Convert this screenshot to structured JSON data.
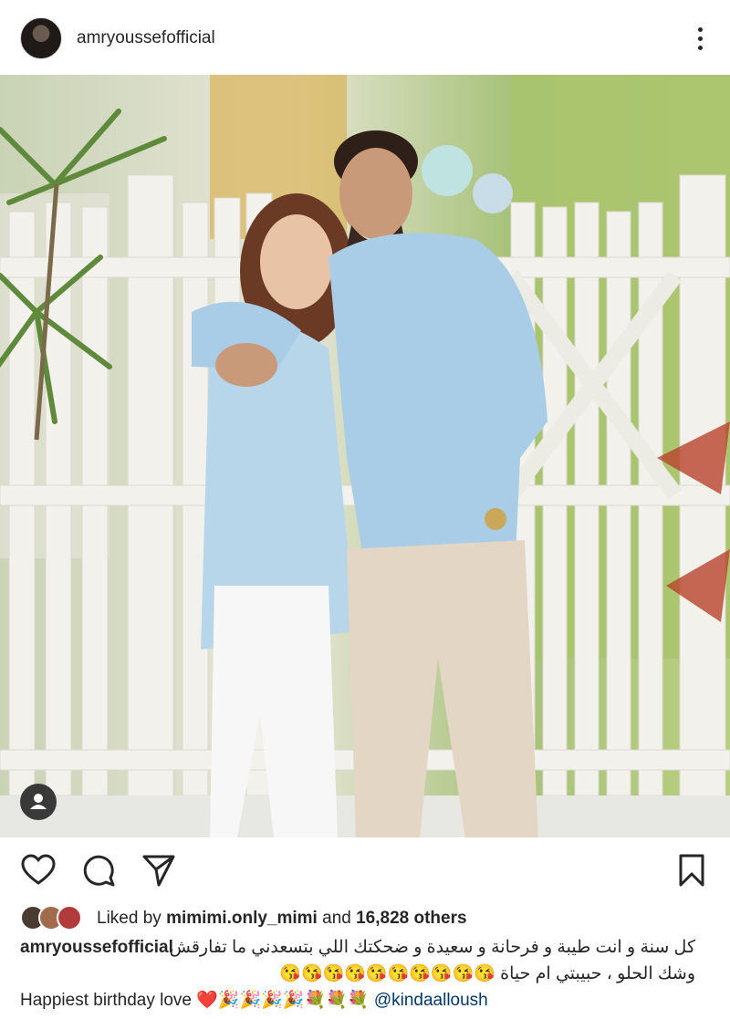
{
  "post": {
    "username": "amryoussefofficial",
    "more_icon": "more-vertical-icon",
    "photo_icon": "person-photo",
    "tag_icon": "user-tag-icon"
  },
  "actions": {
    "like_icon": "heart-icon",
    "comment_icon": "comment-icon",
    "share_icon": "send-icon",
    "save_icon": "bookmark-icon"
  },
  "likes": {
    "prefix": "Liked by",
    "user": "mimimi.only_mimi",
    "middle": "and",
    "count": "16,828 others"
  },
  "caption": {
    "username": "amryoussefofficial",
    "line1": "كل سنة و انت طيبة و فرحانة و سعيدة  و ضحكتك اللي بتسعدني ما تفارقش",
    "line2": "وشك الحلو ، حبيبتي ام حياة 😘😘😘😘😘😘😘😘😘😘",
    "line3_text": "Happiest birthday love ❤️🎉🎉🎉🎉💐💐💐",
    "mention": "@kindaalloush"
  },
  "colors": {
    "text": "#262626",
    "mention": "#00376b",
    "shirt": "#a9cde6",
    "fence": "#f3f1ec",
    "foliage": "#9dbb5f"
  }
}
